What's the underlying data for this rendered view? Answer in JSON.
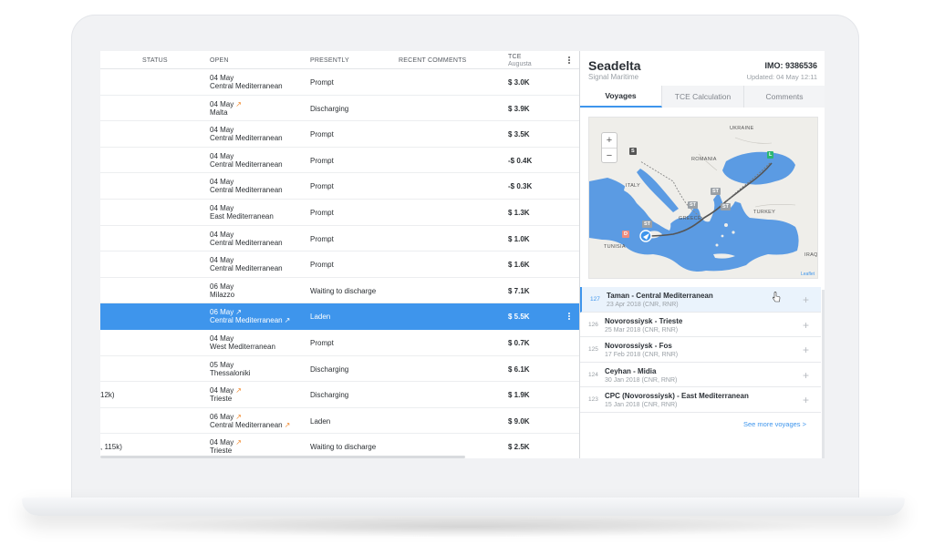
{
  "table": {
    "columns": {
      "status": "STATUS",
      "open": "OPEN",
      "presently": "PRESENTLY",
      "recent_comments": "RECENT COMMENTS",
      "tce": "TCE",
      "tce_sub": "Augusta"
    },
    "rows": [
      {
        "date": "04 May",
        "area": "Central Mediterranean",
        "presently": "Prompt",
        "tce": "$ 3.0K",
        "left": ""
      },
      {
        "date": "04 May",
        "area": "Malta",
        "presently": "Discharging",
        "tce": "$ 3.9K",
        "left": ""
      },
      {
        "date": "04 May",
        "area": "Central Mediterranean",
        "presently": "Prompt",
        "tce": "$ 3.5K",
        "left": ""
      },
      {
        "date": "04 May",
        "area": "Central Mediterranean",
        "presently": "Prompt",
        "tce": "-$ 0.4K",
        "left": ""
      },
      {
        "date": "04 May",
        "area": "Central Mediterranean",
        "presently": "Prompt",
        "tce": "-$ 0.3K",
        "left": ""
      },
      {
        "date": "04 May",
        "area": "East Mediterranean",
        "presently": "Prompt",
        "tce": "$ 1.3K",
        "left": ""
      },
      {
        "date": "04 May",
        "area": "Central Mediterranean",
        "presently": "Prompt",
        "tce": "$ 1.0K",
        "left": ""
      },
      {
        "date": "04 May",
        "area": "Central Mediterranean",
        "presently": "Prompt",
        "tce": "$ 1.6K",
        "left": ""
      },
      {
        "date": "06 May",
        "area": "Milazzo",
        "presently": "Waiting to discharge",
        "tce": "$ 7.1K",
        "left": ""
      },
      {
        "date": "06 May",
        "area": "Central Mediterranean",
        "presently": "Laden",
        "tce": "$ 5.5K",
        "left": ""
      },
      {
        "date": "04 May",
        "area": "West Mediterranean",
        "presently": "Prompt",
        "tce": "$ 0.7K",
        "left": ""
      },
      {
        "date": "05 May",
        "area": "Thessaloniki",
        "presently": "Discharging",
        "tce": "$ 6.1K",
        "left": ""
      },
      {
        "date": "04 May",
        "area": "Trieste",
        "presently": "Discharging",
        "tce": "$ 1.9K",
        "left": "12k)"
      },
      {
        "date": "06 May",
        "area": "Central Mediterranean",
        "presently": "Laden",
        "tce": "$ 9.0K",
        "left": ""
      },
      {
        "date": "04 May",
        "area": "Trieste",
        "presently": "Waiting to discharge",
        "tce": "$ 2.5K",
        "left": ", 115k)"
      }
    ]
  },
  "panel": {
    "vessel_name": "Seadelta",
    "owner": "Signal Maritime",
    "imo": "IMO: 9386536",
    "updated": "Updated: 04 May 12:11",
    "tabs": [
      "Voyages",
      "TCE Calculation",
      "Comments"
    ],
    "map": {
      "zoom_in": "+",
      "zoom_out": "−",
      "countries": [
        "UKRAINE",
        "ROMANIA",
        "ITALY",
        "GREECE",
        "TURKEY",
        "TUNISIA",
        "IRAQ"
      ],
      "markers": [
        "S",
        "L",
        "ST",
        "ST",
        "ST",
        "ST",
        "D"
      ],
      "attribution": "Leaflet"
    },
    "voyages": [
      {
        "num": "127",
        "title": "Taman - Central Mediterranean",
        "sub": "23 Apr 2018 (CNR, RNR)"
      },
      {
        "num": "126",
        "title": "Novorossiysk - Trieste",
        "sub": "25 Mar 2018 (CNR, RNR)"
      },
      {
        "num": "125",
        "title": "Novorossiysk - Fos",
        "sub": "17 Feb 2018 (CNR, RNR)"
      },
      {
        "num": "124",
        "title": "Ceyhan - Midia",
        "sub": "30 Jan 2018 (CNR, RNR)"
      },
      {
        "num": "123",
        "title": "CPC (Novorossiysk) - East Mediterranean",
        "sub": "15 Jan 2018 (CNR, RNR)"
      }
    ],
    "see_more": "See more voyages >",
    "plus": "+"
  },
  "colors": {
    "accent": "#3e95ec",
    "sea": "#5b9be3",
    "land": "#efeeea",
    "trend": "#f28a2e",
    "load_marker": "#2bb673",
    "discharge_marker": "#ef8b7c"
  }
}
